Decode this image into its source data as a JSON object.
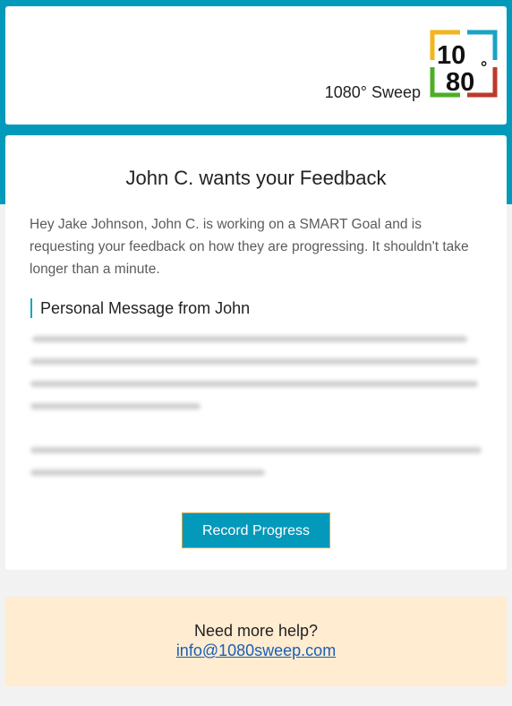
{
  "header": {
    "brand_name": "1080° Sweep",
    "logo": {
      "top_text": "10",
      "bottom_text": "80",
      "degree_symbol": "°",
      "colors": {
        "top_left": "#f2b51c",
        "top_right": "#1aa3c4",
        "bottom_left": "#4caf27",
        "bottom_right": "#c0392b"
      }
    }
  },
  "main": {
    "title": "John C. wants your Feedback",
    "intro": "Hey Jake Johnson, John C. is working on a SMART Goal and is requesting your feedback on how they are progressing. It shouldn't take longer than a minute.",
    "personal_message_heading": "Personal Message from John",
    "personal_message_state": "blurred",
    "record_button_label": "Record Progress"
  },
  "help": {
    "title": "Need more help?",
    "email": "info@1080sweep.com"
  },
  "colors": {
    "accent": "#0399ba",
    "help_background": "#ffecd1",
    "page_background": "#f2f2f2"
  }
}
